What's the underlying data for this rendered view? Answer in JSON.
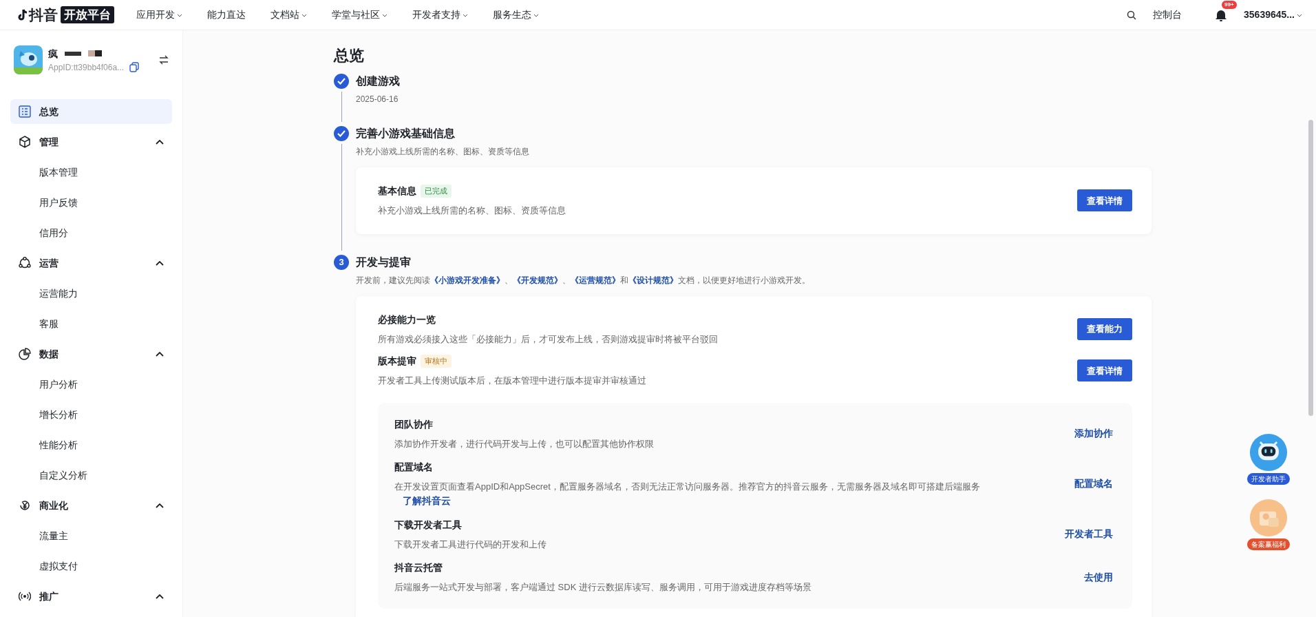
{
  "topbar": {
    "logo_text": "抖音",
    "logo_badge": "开放平台",
    "nav": [
      {
        "label": "应用开发",
        "dropdown": true
      },
      {
        "label": "能力直达",
        "dropdown": false
      },
      {
        "label": "文档站",
        "dropdown": true
      },
      {
        "label": "学堂与社区",
        "dropdown": true
      },
      {
        "label": "开发者支持",
        "dropdown": true
      },
      {
        "label": "服务生态",
        "dropdown": true
      }
    ],
    "console": "控制台",
    "notification_count": "99+",
    "user": "35639645..."
  },
  "app": {
    "name": "疯",
    "app_id": "AppID:tt39bb4f06a..."
  },
  "sidebar": [
    {
      "label": "总览",
      "kind": "overview",
      "selected": true
    },
    {
      "label": "管理",
      "kind": "cube",
      "selected": false,
      "expanded": true,
      "children": [
        {
          "label": "版本管理",
          "selected": false
        },
        {
          "label": "用户反馈",
          "selected": false
        },
        {
          "label": "信用分",
          "selected": false
        }
      ]
    },
    {
      "label": "运营",
      "kind": "operations",
      "selected": false,
      "expanded": true,
      "children": [
        {
          "label": "运营能力",
          "selected": false
        },
        {
          "label": "客服",
          "selected": false
        }
      ]
    },
    {
      "label": "数据",
      "kind": "pie",
      "selected": false,
      "expanded": true,
      "children": [
        {
          "label": "用户分析",
          "selected": false
        },
        {
          "label": "增长分析",
          "selected": false
        },
        {
          "label": "性能分析",
          "selected": false
        },
        {
          "label": "自定义分析",
          "selected": false
        }
      ]
    },
    {
      "label": "商业化",
      "kind": "yen",
      "selected": false,
      "expanded": true,
      "children": [
        {
          "label": "流量主",
          "selected": false
        },
        {
          "label": "虚拟支付",
          "selected": false
        }
      ]
    },
    {
      "label": "推广",
      "kind": "broadcast",
      "selected": false,
      "expanded": true
    }
  ],
  "page_title": "总览",
  "steps": [
    {
      "kind": "done",
      "title": "创建游戏",
      "description": [
        {
          "text": "2025-06-16",
          "link": false
        }
      ]
    },
    {
      "kind": "done",
      "title": "完善小游戏基础信息",
      "description": [
        {
          "text": "补充小游戏上线所需的名称、图标、资质等信息",
          "link": false
        }
      ],
      "cards": [
        {
          "items": [
            {
              "title": "基本信息",
              "tag": {
                "text": "已完成",
                "kind": "done"
              },
              "description": "补充小游戏上线所需的名称、图标、资质等信息",
              "action": "查看详情"
            }
          ]
        }
      ]
    },
    {
      "kind": "current",
      "number": "3",
      "title": "开发与提审",
      "description": [
        {
          "text": "开发前，建议先阅读",
          "link": false
        },
        {
          "text": "《小游戏开发准备》",
          "link": true
        },
        {
          "text": "、",
          "link": false
        },
        {
          "text": "《开发规范》",
          "link": true
        },
        {
          "text": "、",
          "link": false
        },
        {
          "text": "《运营规范》",
          "link": true
        },
        {
          "text": "和",
          "link": false
        },
        {
          "text": "《设计规范》",
          "link": true
        },
        {
          "text": "文档，以便更好地进行小游戏开发。",
          "link": false
        }
      ],
      "cards": [
        {
          "items": [
            {
              "title": "必接能力一览",
              "description": "所有游戏必须接入这些「必接能力」后，才可发布上线，否则游戏提审时将被平台驳回",
              "action": "查看能力"
            },
            {
              "title": "版本提审",
              "tag": {
                "text": "审核中",
                "kind": "review"
              },
              "description": "开发者工具上传测试版本后，在版本管理中进行版本提审并审核通过",
              "action": "查看详情"
            }
          ],
          "extras": [
            {
              "title": "团队协作",
              "description": "添加协作开发者，进行代码开发与上传，也可以配置其他协作权限",
              "action": "添加协作"
            },
            {
              "title": "配置域名",
              "description": "在开发设置页面查看AppID和AppSecret，配置服务器域名，否则无法正常访问服务器。推荐官方的抖音云服务，无需服务器及域名即可搭建后端服务",
              "more": "了解抖音云",
              "action": "配置域名"
            },
            {
              "title": "下载开发者工具",
              "description": "下载开发者工具进行代码的开发和上传",
              "action": "开发者工具"
            },
            {
              "title": "抖音云托管",
              "description": "后端服务一站式开发与部署，客户端通过 SDK 进行云数据库读写、服务调用，可用于游戏进度存档等场景",
              "action": "去使用"
            }
          ]
        }
      ]
    }
  ],
  "floating": [
    {
      "kind": "robot",
      "label": "开发者助手"
    },
    {
      "kind": "gift",
      "label": "备案赢福利"
    }
  ]
}
